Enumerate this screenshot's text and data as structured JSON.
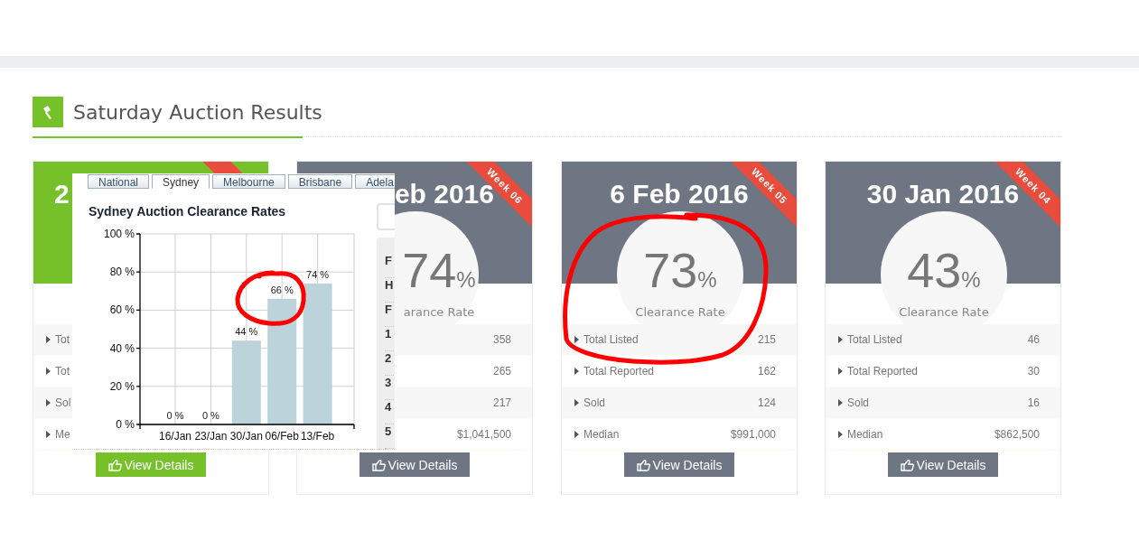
{
  "section": {
    "title": "Saturday Auction Results"
  },
  "cards": [
    {
      "current": true,
      "date": "2",
      "rows": [
        {
          "label": "Tot"
        },
        {
          "label": "Tot"
        },
        {
          "label": "Sol"
        },
        {
          "label": "Me"
        }
      ],
      "button": "View Details"
    },
    {
      "current": false,
      "date": "eb 2016",
      "week": "Week 06",
      "rate": "74",
      "percent": "%",
      "rate_label": "arance Rate",
      "rows": [
        {
          "value": "358"
        },
        {
          "value": "265"
        },
        {
          "value": "217"
        },
        {
          "value": "$1,041,500"
        }
      ],
      "button": "View Details"
    },
    {
      "current": false,
      "date": "6 Feb 2016",
      "week": "Week 05",
      "rate": "73",
      "percent": "%",
      "rate_label": "Clearance Rate",
      "rows": [
        {
          "label": "Total Listed",
          "value": "215"
        },
        {
          "label": "Total Reported",
          "value": "162"
        },
        {
          "label": "Sold",
          "value": "124"
        },
        {
          "label": "Median",
          "value": "$991,000"
        }
      ],
      "button": "View Details"
    },
    {
      "current": false,
      "date": "30 Jan 2016",
      "week": "Week 04",
      "rate": "43",
      "percent": "%",
      "rate_label": "Clearance Rate",
      "rows": [
        {
          "label": "Total Listed",
          "value": "46"
        },
        {
          "label": "Total Reported",
          "value": "30"
        },
        {
          "label": "Sold",
          "value": "16"
        },
        {
          "label": "Median",
          "value": "$862,500"
        }
      ],
      "button": "View Details"
    }
  ],
  "popup": {
    "tabs": [
      {
        "label": "National",
        "selected": false
      },
      {
        "label": "Sydney",
        "selected": true
      },
      {
        "label": "Melbourne",
        "selected": false
      },
      {
        "label": "Brisbane",
        "selected": false
      },
      {
        "label": "Adela",
        "selected": false
      }
    ],
    "chart_data": {
      "type": "bar",
      "title": "Sydney Auction Clearance Rates",
      "categories": [
        "16/Jan",
        "23/Jan",
        "30/Jan",
        "06/Feb",
        "13/Feb"
      ],
      "series": [
        {
          "color": "#bcd3da",
          "values": [
            0,
            0,
            44,
            66,
            74
          ]
        }
      ],
      "grid": true,
      "ylim": [
        0,
        100
      ],
      "yticks": [
        {
          "value": 0,
          "label": "0 %"
        },
        {
          "value": 20,
          "label": "20 %"
        },
        {
          "value": 40,
          "label": "40 %"
        },
        {
          "value": 60,
          "label": "60 %"
        },
        {
          "value": 80,
          "label": "80 %"
        },
        {
          "value": 100,
          "label": "100 %"
        }
      ],
      "value_labels": [
        "0 %",
        "0 %",
        "44 %",
        "66 %",
        "74 %"
      ]
    },
    "side_panel": [
      "F",
      "H",
      "F",
      "1",
      "2",
      "3",
      "4",
      "5"
    ]
  }
}
